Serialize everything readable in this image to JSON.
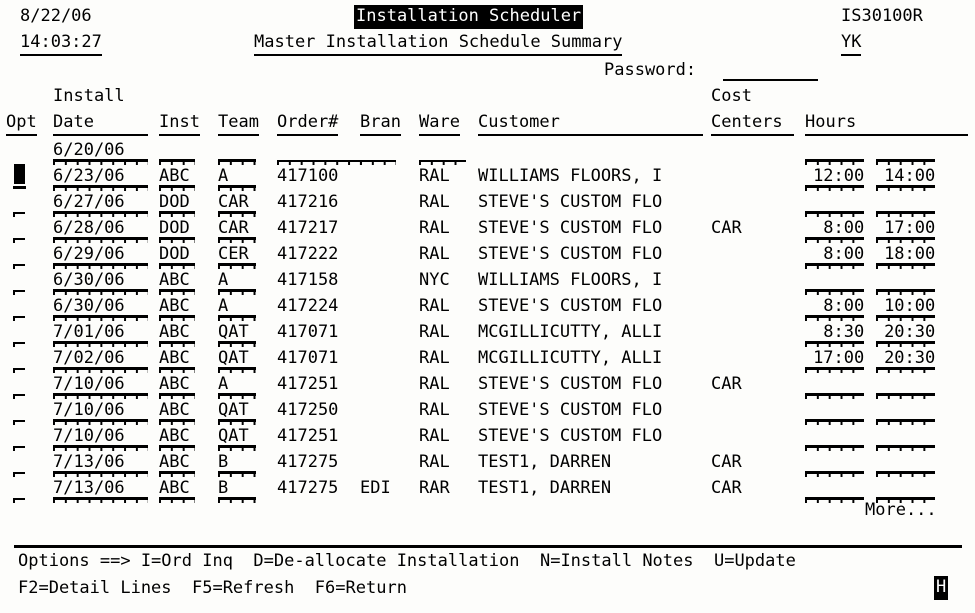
{
  "screen": {
    "title": "Installation Scheduler",
    "subtitle": "Master Installation Schedule Summary",
    "date": "8/22/06",
    "time": "14:03:27",
    "program_id": "IS30100R",
    "user_id": "YK",
    "password_label": "Password:",
    "password_value": "",
    "more_indicator": "More...",
    "input_inhibited_indicator": "H"
  },
  "columns": {
    "opt": "Opt",
    "install": "Install",
    "date": "Date",
    "inst": "Inst",
    "team": "Team",
    "order": "Order#",
    "bran": "Bran",
    "ware": "Ware",
    "customer": "Customer",
    "cost": "Cost",
    "centers": "Centers",
    "hours": "Hours"
  },
  "rows": [
    {
      "opt": "",
      "date": "6/20/06",
      "inst": "",
      "team": "",
      "order": "",
      "bran": "",
      "ware": "",
      "customer": "",
      "cost_center": "",
      "hour_start": "",
      "hour_end": ""
    },
    {
      "opt": "",
      "date": "6/23/06",
      "inst": "ABC",
      "team": "A",
      "order": "417100",
      "bran": "",
      "ware": "RAL",
      "customer": "WILLIAMS FLOORS, I",
      "cost_center": "",
      "hour_start": "12:00",
      "hour_end": "14:00"
    },
    {
      "opt": "",
      "date": "6/27/06",
      "inst": "DOD",
      "team": "CAR",
      "order": "417216",
      "bran": "",
      "ware": "RAL",
      "customer": "STEVE'S CUSTOM FLO",
      "cost_center": "",
      "hour_start": "",
      "hour_end": ""
    },
    {
      "opt": "",
      "date": "6/28/06",
      "inst": "DOD",
      "team": "CAR",
      "order": "417217",
      "bran": "",
      "ware": "RAL",
      "customer": "STEVE'S CUSTOM FLO",
      "cost_center": "CAR",
      "hour_start": "8:00",
      "hour_end": "17:00"
    },
    {
      "opt": "",
      "date": "6/29/06",
      "inst": "DOD",
      "team": "CER",
      "order": "417222",
      "bran": "",
      "ware": "RAL",
      "customer": "STEVE'S CUSTOM FLO",
      "cost_center": "",
      "hour_start": "8:00",
      "hour_end": "18:00"
    },
    {
      "opt": "",
      "date": "6/30/06",
      "inst": "ABC",
      "team": "A",
      "order": "417158",
      "bran": "",
      "ware": "NYC",
      "customer": "WILLIAMS FLOORS, I",
      "cost_center": "",
      "hour_start": "",
      "hour_end": ""
    },
    {
      "opt": "",
      "date": "6/30/06",
      "inst": "ABC",
      "team": "A",
      "order": "417224",
      "bran": "",
      "ware": "RAL",
      "customer": "STEVE'S CUSTOM FLO",
      "cost_center": "",
      "hour_start": "8:00",
      "hour_end": "10:00"
    },
    {
      "opt": "",
      "date": "7/01/06",
      "inst": "ABC",
      "team": "QAT",
      "order": "417071",
      "bran": "",
      "ware": "RAL",
      "customer": "MCGILLICUTTY, ALLI",
      "cost_center": "",
      "hour_start": "8:30",
      "hour_end": "20:30"
    },
    {
      "opt": "",
      "date": "7/02/06",
      "inst": "ABC",
      "team": "QAT",
      "order": "417071",
      "bran": "",
      "ware": "RAL",
      "customer": "MCGILLICUTTY, ALLI",
      "cost_center": "",
      "hour_start": "17:00",
      "hour_end": "20:30"
    },
    {
      "opt": "",
      "date": "7/10/06",
      "inst": "ABC",
      "team": "A",
      "order": "417251",
      "bran": "",
      "ware": "RAL",
      "customer": "STEVE'S CUSTOM FLO",
      "cost_center": "CAR",
      "hour_start": "",
      "hour_end": ""
    },
    {
      "opt": "",
      "date": "7/10/06",
      "inst": "ABC",
      "team": "QAT",
      "order": "417250",
      "bran": "",
      "ware": "RAL",
      "customer": "STEVE'S CUSTOM FLO",
      "cost_center": "",
      "hour_start": "",
      "hour_end": ""
    },
    {
      "opt": "",
      "date": "7/10/06",
      "inst": "ABC",
      "team": "QAT",
      "order": "417251",
      "bran": "",
      "ware": "RAL",
      "customer": "STEVE'S CUSTOM FLO",
      "cost_center": "",
      "hour_start": "",
      "hour_end": ""
    },
    {
      "opt": "",
      "date": "7/13/06",
      "inst": "ABC",
      "team": "B",
      "order": "417275",
      "bran": "",
      "ware": "RAL",
      "customer": "TEST1, DARREN",
      "cost_center": "CAR",
      "hour_start": "",
      "hour_end": ""
    },
    {
      "opt": "",
      "date": "7/13/06",
      "inst": "ABC",
      "team": "B",
      "order": "417275",
      "bran": "EDI",
      "ware": "RAR",
      "customer": "TEST1, DARREN",
      "cost_center": "CAR",
      "hour_start": "",
      "hour_end": ""
    }
  ],
  "footer": {
    "options_line": "Options ==> I=Ord Inq  D=De-allocate Installation  N=Install Notes  U=Update",
    "function_keys": "F2=Detail Lines  F5=Refresh  F6=Return"
  },
  "colors": {
    "foreground": "#000000",
    "background": "#fdfdfb"
  }
}
